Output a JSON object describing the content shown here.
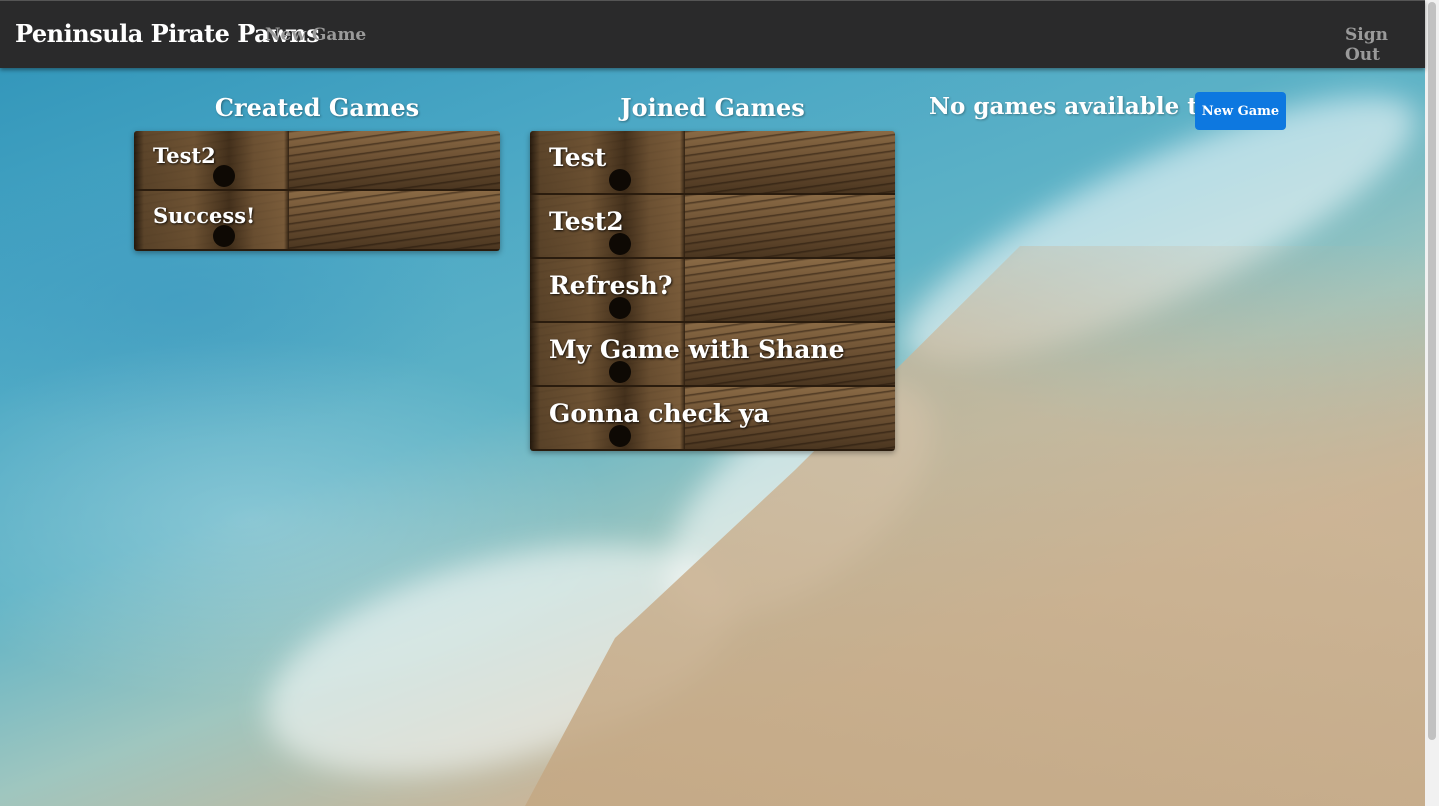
{
  "navbar": {
    "brand": "Peninsula Pirate Pawns",
    "new_game": "New Game",
    "sign_out": "Sign Out"
  },
  "created_games": {
    "title": "Created Games",
    "items": [
      "Test2",
      "Success!"
    ]
  },
  "joined_games": {
    "title": "Joined Games",
    "items": [
      "Test",
      "Test2",
      "Refresh?",
      "My Game with Shane",
      "Gonna check ya"
    ]
  },
  "available_games": {
    "empty_message": "No games available to join.",
    "new_game_button": "New Game"
  },
  "colors": {
    "navbar_bg": "#2a2a2b",
    "button_primary": "#0d78e0"
  }
}
